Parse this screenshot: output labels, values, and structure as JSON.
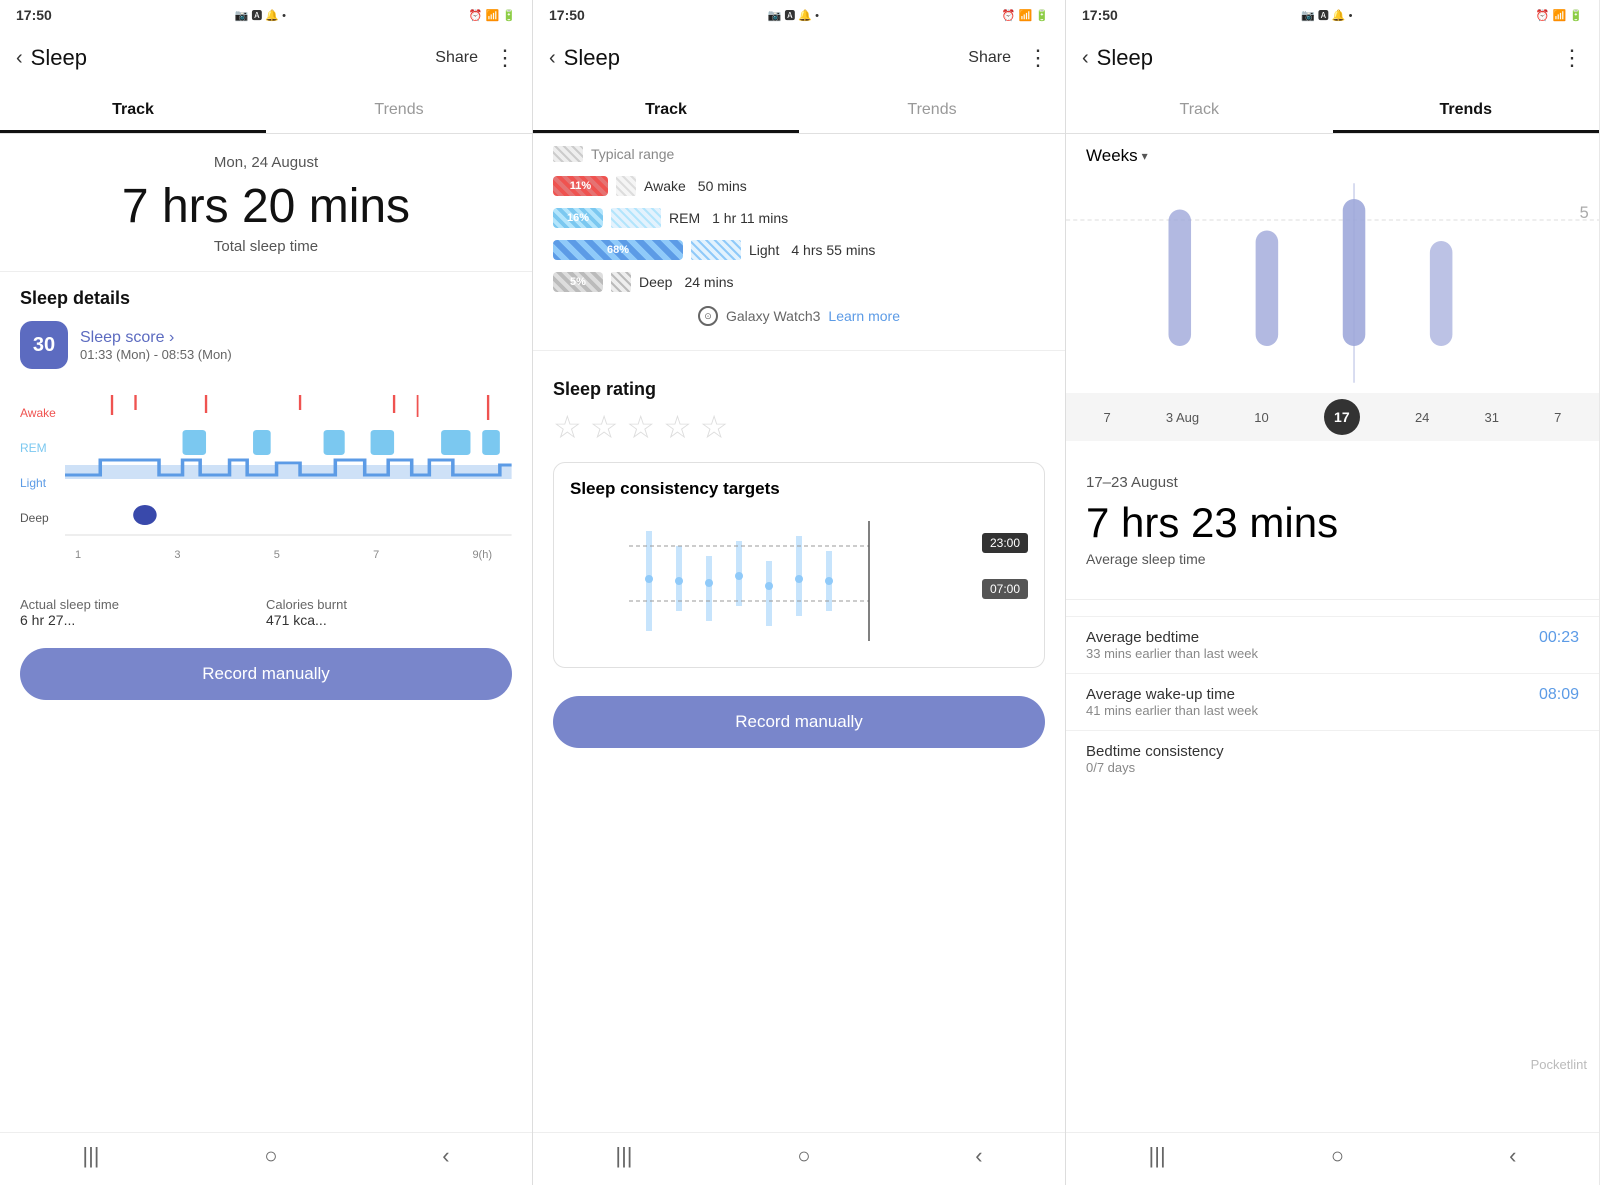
{
  "panels": [
    {
      "id": "panel1",
      "status_time": "17:50",
      "header": {
        "back": "‹",
        "title": "Sleep",
        "share": "Share",
        "menu": "⋮"
      },
      "tabs": [
        {
          "label": "Track",
          "active": true
        },
        {
          "label": "Trends",
          "active": false
        }
      ],
      "date": "Mon, 24 August",
      "sleep_hours": "7 hrs",
      "sleep_mins": "20 mins",
      "sleep_total_label": "Total sleep time",
      "section_title": "Sleep details",
      "score_value": "30",
      "score_label": "Sleep score ›",
      "score_time": "01:33 (Mon) - 08:53 (Mon)",
      "chart_labels": [
        "Awake",
        "REM",
        "Light",
        "Deep"
      ],
      "chart_times": [
        "1",
        "3",
        "5",
        "7",
        "9(h)"
      ],
      "actual_sleep_label": "Actual sleep time",
      "actual_sleep_value": "6 hr 27...",
      "calories_label": "Calories burnt",
      "calories_value": "471 kca...",
      "record_btn": "Record manually",
      "nav": [
        "|||",
        "○",
        "‹"
      ]
    },
    {
      "id": "panel2",
      "status_time": "17:50",
      "header": {
        "back": "‹",
        "title": "Sleep",
        "share": "Share",
        "menu": "⋮"
      },
      "tabs": [
        {
          "label": "Track",
          "active": true
        },
        {
          "label": "Trends",
          "active": false
        }
      ],
      "typical_range": "Typical range",
      "legend": [
        {
          "type": "awake",
          "pct": "11%",
          "name": "Awake",
          "duration": "50 mins"
        },
        {
          "type": "rem",
          "pct": "16%",
          "name": "REM",
          "duration": "1 hr 11 mins"
        },
        {
          "type": "light",
          "pct": "68%",
          "name": "Light",
          "duration": "4 hrs 55 mins"
        },
        {
          "type": "deep",
          "pct": "5%",
          "name": "Deep",
          "duration": "24 mins"
        }
      ],
      "device": "Galaxy Watch3",
      "learn_more": "Learn more",
      "rating_title": "Sleep rating",
      "stars": [
        "★",
        "★",
        "★",
        "★",
        "★"
      ],
      "consistency_title": "Sleep consistency targets",
      "consistency_time1": "23:00",
      "consistency_time2": "07:00",
      "record_btn": "Record manually",
      "nav": [
        "|||",
        "○",
        "‹"
      ]
    },
    {
      "id": "panel3",
      "status_time": "17:50",
      "header": {
        "back": "‹",
        "title": "Sleep",
        "menu": "⋮"
      },
      "tabs": [
        {
          "label": "Track",
          "active": false
        },
        {
          "label": "Trends",
          "active": true
        }
      ],
      "period_selector": "Weeks",
      "period_arrow": "▾",
      "date_labels": [
        "7",
        "3 Aug",
        "10",
        "17",
        "24",
        "31",
        "7"
      ],
      "selected_date": "17",
      "date_range": "17–23 August",
      "avg_hours": "7 hrs",
      "avg_mins": "23 mins",
      "avg_label": "Average sleep time",
      "metrics": [
        {
          "name": "Average bedtime",
          "sub": "33 mins earlier than last week",
          "value": "00:23"
        },
        {
          "name": "Average wake-up time",
          "sub": "41 mins earlier than last week",
          "value": "08:09"
        },
        {
          "name": "Bedtime consistency",
          "sub": "0/7 days",
          "value": ""
        }
      ],
      "nav": [
        "|||",
        "○",
        "‹"
      ],
      "watermark": "Pocketlint"
    }
  ]
}
